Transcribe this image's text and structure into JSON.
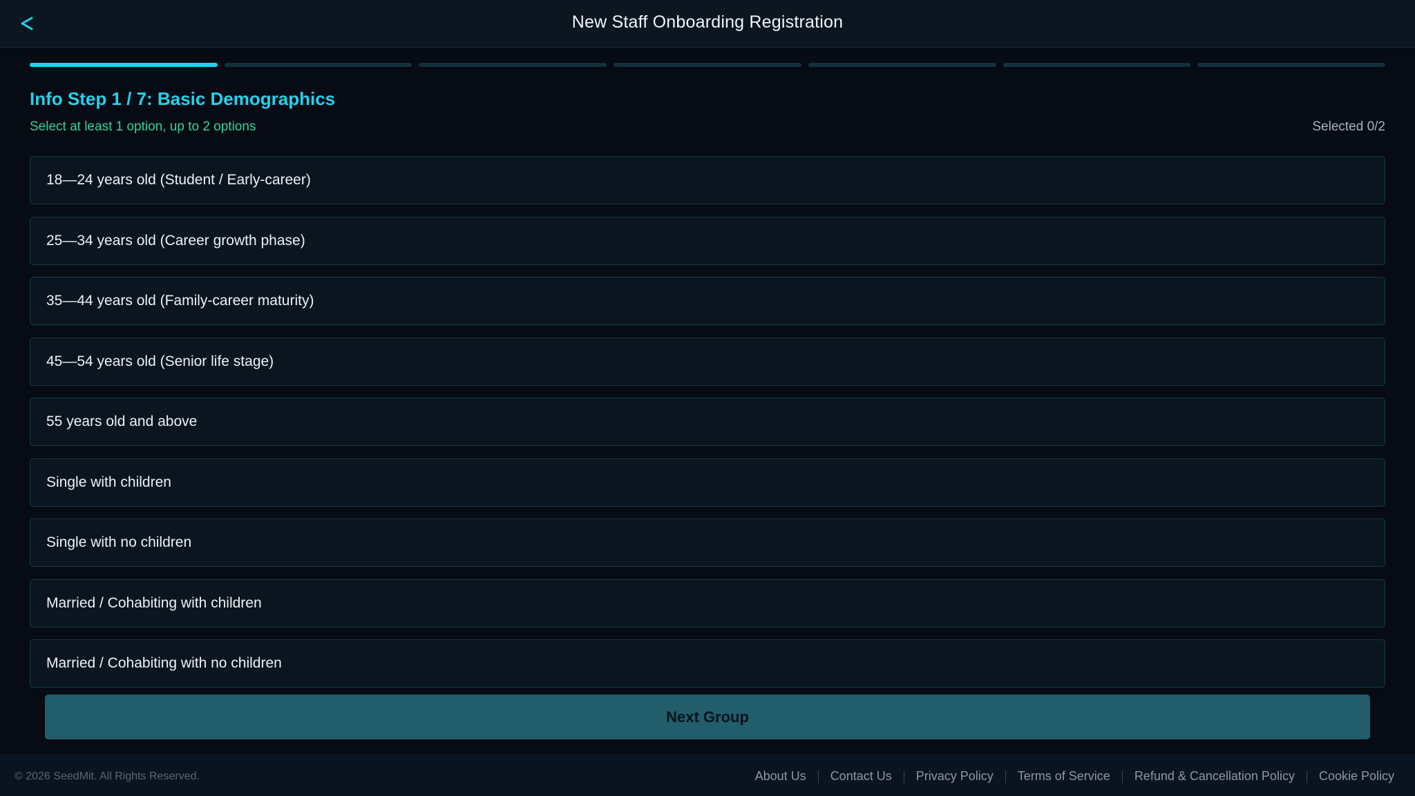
{
  "header": {
    "title": "New Staff Onboarding Registration",
    "back_icon": "chevron-left-icon"
  },
  "progress": {
    "total_steps": 7,
    "current_step": 1
  },
  "step": {
    "title": "Info Step 1 / 7: Basic Demographics",
    "hint": "Select at least 1 option, up to 2 options",
    "selected_count": "Selected 0/2"
  },
  "options": [
    "18—24 years old (Student / Early-career)",
    "25—34 years old (Career growth phase)",
    "35—44 years old (Family-career maturity)",
    "45—54 years old (Senior life stage)",
    "55 years old and above",
    "Single with children",
    "Single with no children",
    "Married / Cohabiting with children",
    "Married / Cohabiting with no children"
  ],
  "next_button": "Next Group",
  "footer": {
    "copyright": "© 2026 SeedMit. All Rights Reserved.",
    "links": [
      "About Us",
      "Contact Us",
      "Privacy Policy",
      "Terms of Service",
      "Refund & Cancellation Policy",
      "Cookie Policy"
    ]
  },
  "colors": {
    "accent": "#22d3ee",
    "hint": "#34d399",
    "button": "#215d6a",
    "background": "#060b14"
  }
}
